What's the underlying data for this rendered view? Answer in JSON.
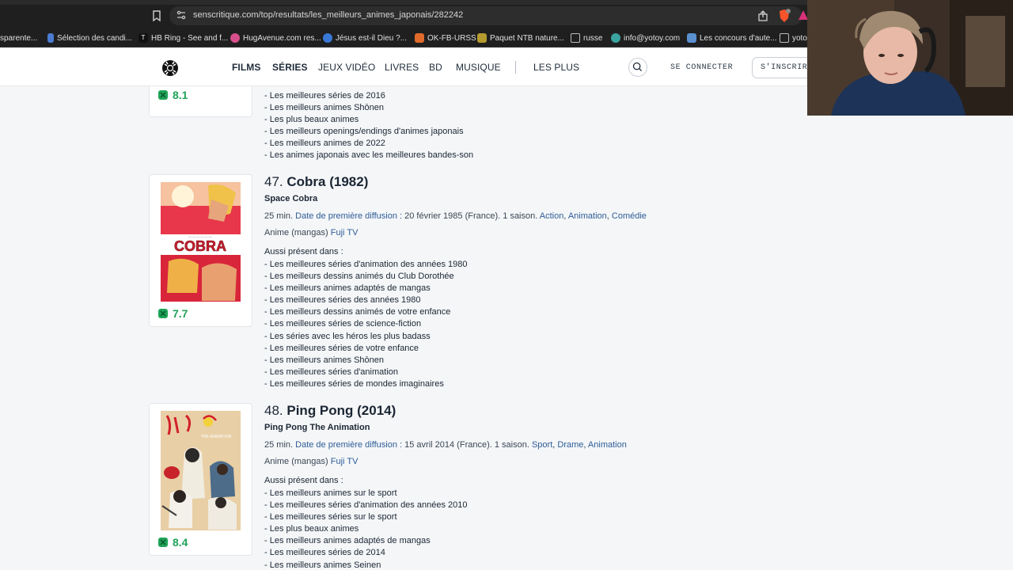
{
  "browser": {
    "url": "senscritique.com/top/resultats/les_meilleurs_animes_japonais/282242",
    "bookmarks": [
      {
        "label": "sparente...",
        "color": "#888"
      },
      {
        "label": "Sélection des candi...",
        "color": "#4a7bd0"
      },
      {
        "label": "HB Ring - See and f...",
        "color": "#111"
      },
      {
        "label": "HugAvenue.com res...",
        "color": "#d64f8a"
      },
      {
        "label": "Jésus est-il Dieu ?...",
        "color": "#3a78d8"
      },
      {
        "label": "OK-FB-URSS",
        "color": "#e06a2a"
      },
      {
        "label": "Paquet NTB nature...",
        "color": "#b59b2f"
      },
      {
        "label": "russe",
        "color": "#bbb"
      },
      {
        "label": "info@yotoy.com",
        "color": "#3aa3a0"
      },
      {
        "label": "Les concours d'aute...",
        "color": "#5a8fd0"
      },
      {
        "label": "yoto",
        "color": "#bbb"
      }
    ]
  },
  "site": {
    "nav": [
      "FILMS",
      "SÉRIES",
      "JEUX VIDÉO",
      "LIVRES",
      "BD",
      "MUSIQUE",
      "LES PLUS"
    ],
    "login": "SE CONNECTER",
    "signup": "S'INSCRIRE"
  },
  "prev_entry": {
    "rating": "8.1",
    "lists": [
      "- Les meilleures séries de 2016",
      "- Les meilleurs animes Shōnen",
      "- Les plus beaux animes",
      "- Les meilleurs openings/endings d'animes japonais",
      "- Les meilleurs animes de 2022",
      "- Les animes japonais avec les meilleures bandes-son"
    ]
  },
  "entries": [
    {
      "rank": "47.",
      "title": "Cobra (1982)",
      "original_title": "Space Cobra",
      "duration": "25 min.",
      "first_air_label": "Date de première diffusion :",
      "first_air_value": "20 février 1985 (France).",
      "seasons": "1 saison.",
      "genres": [
        "Action",
        "Animation",
        "Comédie"
      ],
      "origin_label": "Anime (mangas)",
      "channel": "Fuji TV",
      "aussi_label": "Aussi présent dans :",
      "rating": "7.7",
      "poster_text": "COBRA",
      "lists": [
        "- Les meilleures séries d'animation des années 1980",
        "- Les meilleurs dessins animés du Club Dorothée",
        "- Les meilleurs animes adaptés de mangas",
        "- Les meilleures séries des années 1980",
        "- Les meilleurs dessins animés de votre enfance",
        "- Les meilleures séries de science-fiction",
        "- Les séries avec les héros les plus badass",
        "- Les meilleures séries de votre enfance",
        "- Les meilleurs animes Shōnen",
        "- Les meilleures séries d'animation",
        "- Les meilleures séries de mondes imaginaires"
      ]
    },
    {
      "rank": "48.",
      "title": "Ping Pong (2014)",
      "original_title": "Ping Pong The Animation",
      "duration": "25 min.",
      "first_air_label": "Date de première diffusion :",
      "first_air_value": "15 avril 2014 (France).",
      "seasons": "1 saison.",
      "genres": [
        "Sport",
        "Drame",
        "Animation"
      ],
      "origin_label": "Anime (mangas)",
      "channel": "Fuji TV",
      "aussi_label": "Aussi présent dans :",
      "rating": "8.4",
      "poster_text": "THE ANIMATION",
      "lists": [
        "- Les meilleurs animes sur le sport",
        "- Les meilleures séries d'animation des années 2010",
        "- Les meilleures séries sur le sport",
        "- Les plus beaux animes",
        "- Les meilleurs animes adaptés de mangas",
        "- Les meilleures séries de 2014",
        "- Les meilleurs animes Seinen"
      ]
    }
  ],
  "colors": {
    "rating_green": "#1fa458",
    "link_blue": "#2e5c97"
  }
}
